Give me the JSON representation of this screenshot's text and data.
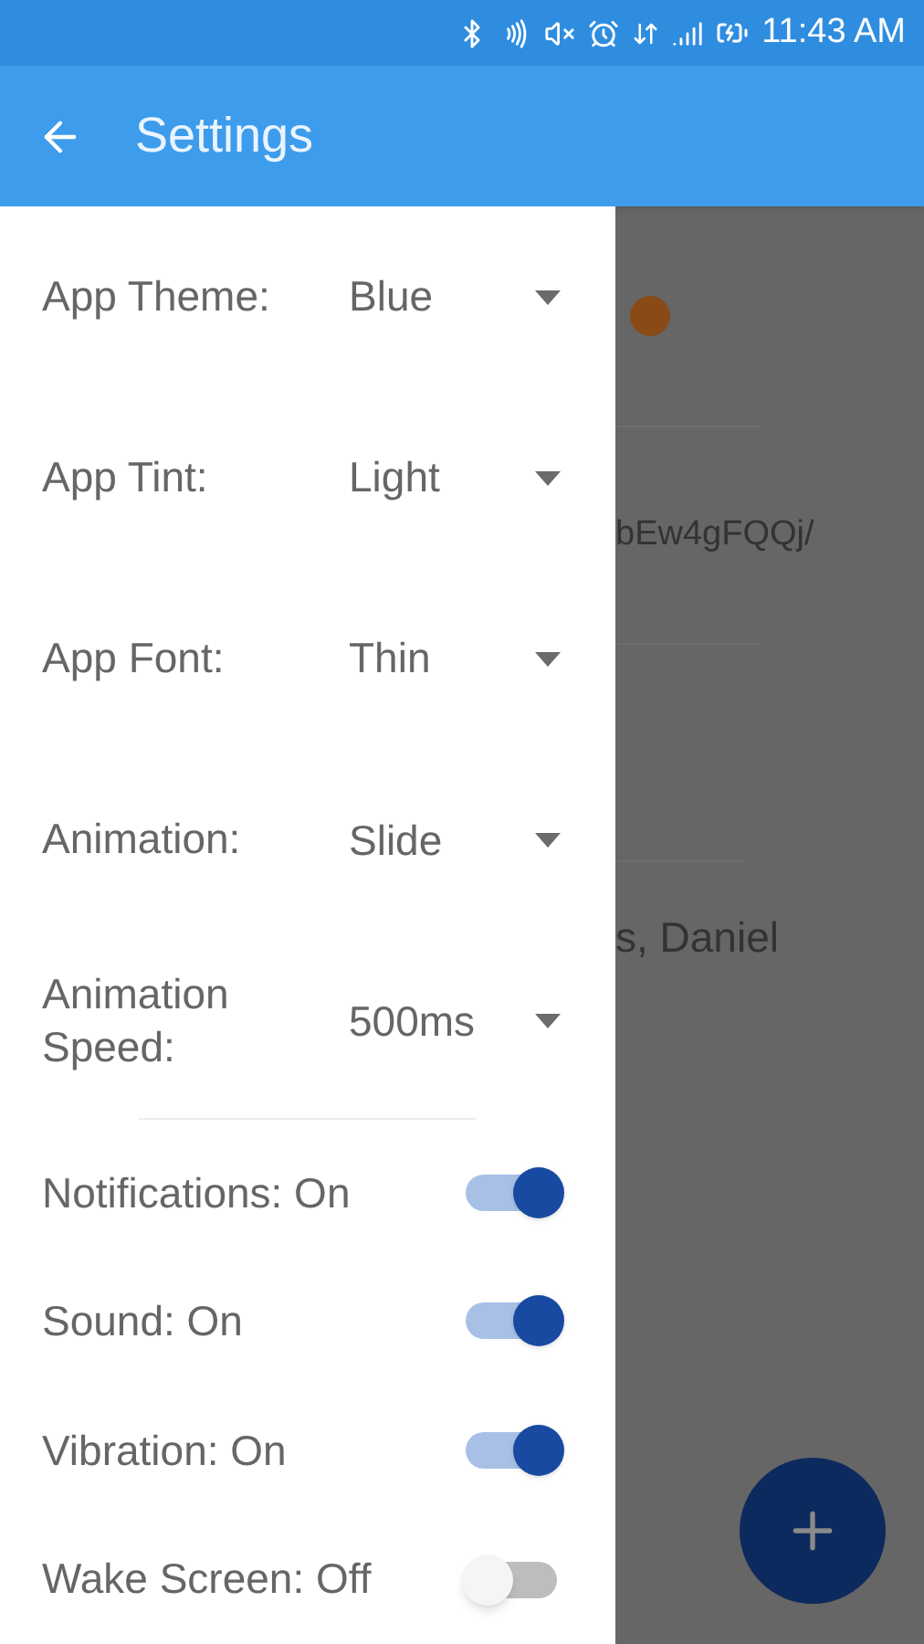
{
  "status_bar": {
    "time": "11:43 AM"
  },
  "app_bar": {
    "title": "Settings"
  },
  "background_list": [
    {
      "text": "bEw4gFQQj/"
    },
    {
      "text": "s, Daniel"
    }
  ],
  "settings": [
    {
      "kind": "dropdown",
      "label": "App Theme:",
      "value": "Blue"
    },
    {
      "kind": "dropdown",
      "label": "App Tint:",
      "value": "Light"
    },
    {
      "kind": "dropdown",
      "label": "App Font:",
      "value": "Thin"
    },
    {
      "kind": "dropdown",
      "label": "Animation:",
      "value": "Slide"
    },
    {
      "kind": "dropdown",
      "label": "Animation Speed:",
      "value": "500ms"
    },
    {
      "kind": "divider"
    },
    {
      "kind": "toggle",
      "label": "Notifications: On",
      "on": true
    },
    {
      "kind": "toggle",
      "label": "Sound: On",
      "on": true
    },
    {
      "kind": "toggle",
      "label": "Vibration: On",
      "on": true
    },
    {
      "kind": "toggle",
      "label": "Wake Screen: Off",
      "on": false
    }
  ]
}
